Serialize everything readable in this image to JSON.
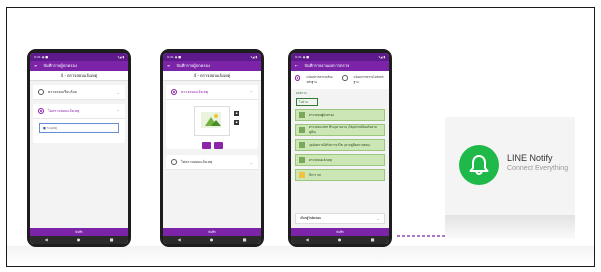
{
  "phone1": {
    "status_left": "9:41 ◉ ■",
    "status_right": "▾◢ ▮",
    "appbar_title": "บันทึกรายผู้ปกครอง",
    "subtitle": "4 - ตรวจสอบแจ้งเหตุ",
    "option_1": "ตรวจสอบเรียบร้อย",
    "option_2": "ไม่ตรวจสอบแจ้งเหตุ",
    "input_placeholder": "ระบุเหตุ",
    "bottom_button": "บันทึก"
  },
  "phone2": {
    "status_left": "9:41 ◉ ■",
    "status_right": "▾◢ ▮",
    "appbar_title": "บันทึกรายผู้ปกครอง",
    "subtitle": "4 - ตรวจสอบแจ้งเหตุ",
    "option_1": "ตรวจสอบแจ้งเหตุ",
    "option_2": "ไม่ตรวจสอบแจ้งเหตุ",
    "bottom_button": "บันทึก"
  },
  "phone3": {
    "status_left": "9:41 ◉ ■",
    "status_right": "▾◢ ▮",
    "appbar_title": "บันทึกรายงานผลการตรวจ",
    "opt_a": "แจ้งผลการตรวจพร้อมหลักฐาน",
    "opt_b": "แจ้งผลการตรวจไม่มีหลักฐาน",
    "tag_label": "ผลตรวจ",
    "tag_value": "ไม่ผ่าน",
    "items": [
      "ตรวจสอบผู้ปกครอง",
      "ตรวจสอบ PPE ที่ระบุตามงาน (ใส่อุปกรณ์ป้องกันตามคู่มือ)",
      "จุดอันตรายได้รับการแก้ไข (ตามคู่มือตรวจสอบ)",
      "ตรวจสอบแจ้งเหตุ",
      "มีการ 5ส"
    ],
    "dropdown_label": "เลือกผู้รับผิดชอบ",
    "bottom_button": "บันทึก"
  },
  "nav": {
    "back": "◀",
    "home": "●",
    "recent": "■"
  },
  "line_notify": {
    "title": "LINE Notify",
    "subtitle": "Connect Everything",
    "brand_color": "#1fb94a"
  },
  "accent_color": "#7b24a8"
}
